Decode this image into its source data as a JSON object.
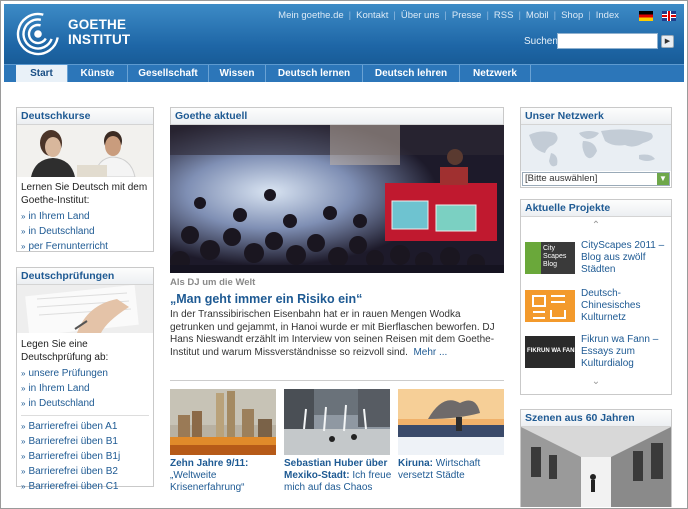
{
  "header": {
    "logo_text_1": "GOETHE",
    "logo_text_2": "INSTITUT",
    "top_links": [
      "Mein goethe.de",
      "Kontakt",
      "Über uns",
      "Presse",
      "RSS",
      "Mobil",
      "Shop",
      "Index"
    ],
    "search_label": "Suchen",
    "search_value": "",
    "languages": [
      "Deutsch",
      "English"
    ]
  },
  "nav": {
    "items": [
      "Start",
      "Künste",
      "Gesellschaft",
      "Wissen",
      "Deutsch lernen",
      "Deutsch lehren",
      "Netzwerk"
    ],
    "active": "Start"
  },
  "left": {
    "courses": {
      "title": "Deutschkurse",
      "intro": "Lernen Sie Deutsch mit dem Goethe-Institut:",
      "links": [
        "in Ihrem Land",
        "in Deutschland",
        "per Fernunterricht"
      ]
    },
    "exams": {
      "title": "Deutschprüfungen",
      "intro": "Legen Sie eine Deutschprüfung ab:",
      "links": [
        "unsere Prüfungen",
        "in Ihrem Land",
        "in Deutschland"
      ],
      "barrier_links": [
        "Barrierefrei üben A1",
        "Barrierefrei üben B1",
        "Barrierefrei üben B1j",
        "Barrierefrei üben B2",
        "Barrierefrei üben C1"
      ]
    }
  },
  "main": {
    "section_title": "Goethe aktuell",
    "kicker": "Als DJ um die Welt",
    "headline": "„Man geht immer ein Risiko ein“",
    "body": "In der Transsibirischen Eisenbahn hat er in rauen Mengen Wodka getrunken und gejammt, in Hanoi wurde er mit Bierflaschen beworfen. DJ Hans Nieswandt erzählt im Interview von seinen Reisen mit dem Goethe-Institut und warum Missverständnisse so reizvoll sind.",
    "more": "Mehr ...",
    "articles": [
      {
        "title": "Zehn Jahre 9/11:",
        "text": "„Weltweite Krisenerfahrung“"
      },
      {
        "title": "Sebastian Huber über Mexiko-Stadt:",
        "text": "Ich freue mich auf das Chaos"
      },
      {
        "title": "Kiruna:",
        "text": "Wirtschaft versetzt Städte"
      }
    ]
  },
  "right": {
    "network": {
      "title": "Unser Netzwerk",
      "select_value": "[Bitte auswählen]"
    },
    "projects": {
      "title": "Aktuelle Projekte",
      "items": [
        {
          "text": "CityScapes 2011 – Blog aus zwölf Städten",
          "thumb_text": "City Scapes Blog",
          "color": "#3a3a3a"
        },
        {
          "text": "Deutsch-Chinesisches Kulturnetz",
          "thumb_text": "",
          "color": "#f39a2c"
        },
        {
          "text": "Fikrun wa Fann – Essays zum Kulturdialog",
          "thumb_text": "FIKRUN WA FANN",
          "color": "#2a2a2a"
        }
      ]
    },
    "sixty": {
      "title": "Szenen aus 60 Jahren"
    }
  },
  "colors": {
    "brand_blue": "#2c76b9",
    "link": "#1e5a93",
    "orange": "#f39a2c"
  }
}
